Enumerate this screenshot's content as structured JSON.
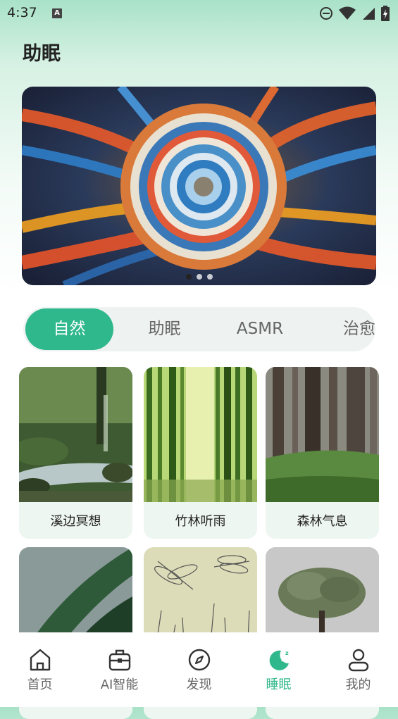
{
  "status_bar": {
    "time": "4:37",
    "a_badge": "A"
  },
  "page": {
    "title": "助眠"
  },
  "banner": {
    "dots": 3,
    "active_dot": 0
  },
  "tabs": [
    {
      "label": "自然",
      "active": true
    },
    {
      "label": "助眠",
      "active": false
    },
    {
      "label": "ASMR",
      "active": false
    },
    {
      "label": "治愈",
      "active": false
    }
  ],
  "cards": [
    {
      "label": "溪边冥想"
    },
    {
      "label": "竹林听雨"
    },
    {
      "label": "森林气息"
    },
    {
      "label": ""
    },
    {
      "label": ""
    },
    {
      "label": ""
    }
  ],
  "nav": {
    "home": "首页",
    "ai": "AI智能",
    "discover": "发现",
    "sleep": "睡眠",
    "mine": "我的"
  },
  "colors": {
    "accent": "#2fb88b",
    "nav_inactive": "#666666"
  }
}
